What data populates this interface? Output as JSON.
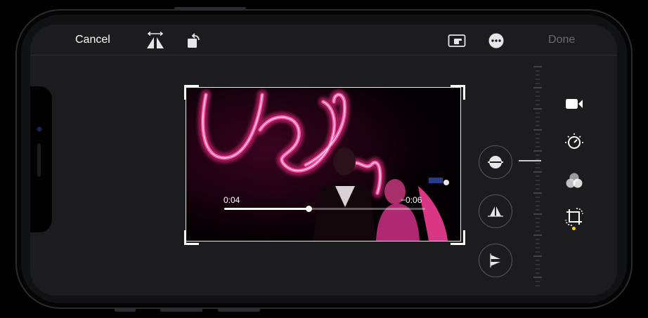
{
  "toolbar": {
    "cancel_label": "Cancel",
    "done_label": "Done",
    "icons": [
      "flip-horizontal-icon",
      "rotate-icon",
      "aspect-ratio-icon",
      "more-icon"
    ]
  },
  "player": {
    "elapsed": "0:04",
    "remaining": "−0:06",
    "progress": 0.42
  },
  "adjustments": {
    "icons": [
      "straighten-icon",
      "vertical-perspective-icon",
      "horizontal-perspective-icon"
    ]
  },
  "tools": {
    "icons": [
      "video-camera-icon",
      "adjust-dial-icon",
      "filters-icon",
      "crop-rotate-icon"
    ],
    "active": "crop-rotate-icon"
  },
  "colors": {
    "accent": "#ffd60a",
    "neon": "#ff2d8a",
    "background": "#1c1c1e"
  }
}
